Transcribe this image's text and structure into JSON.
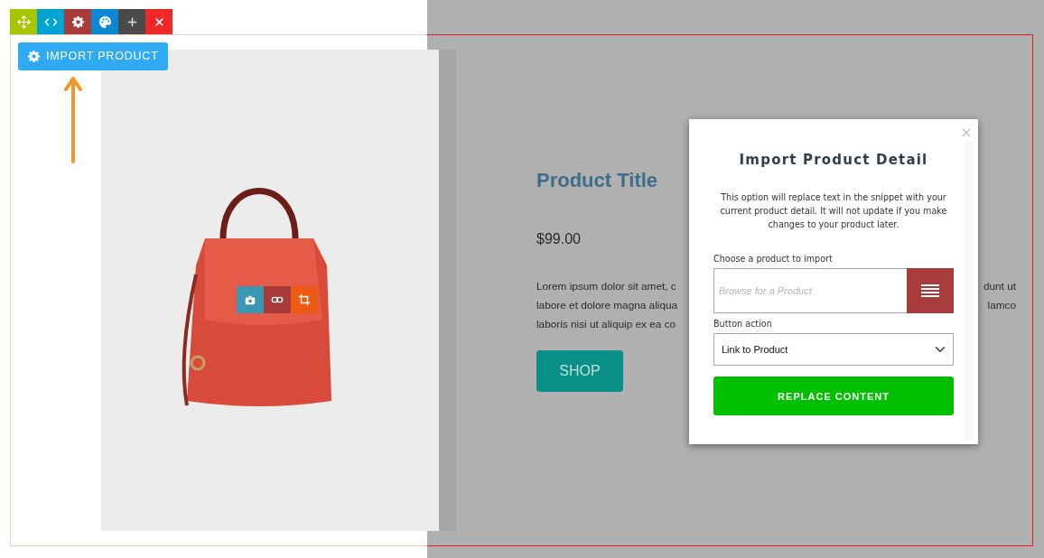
{
  "import_button": {
    "label": "IMPORT PRODUCT"
  },
  "product": {
    "title": "Product Title",
    "price": "$99.00",
    "description_lines": [
      {
        "left": "Lorem ipsum dolor sit amet, c",
        "right": "dunt ut"
      },
      {
        "left": "labore et dolore magna aliqua",
        "right": "lamco"
      },
      {
        "left": "laboris nisi ut aliquip ex ea co"
      }
    ],
    "button": "SHOP"
  },
  "dialog": {
    "title": "Import Product Detail",
    "description": "This option will replace text in the snippet with your current product detail. It will not update if you make changes to your product later.",
    "product_label": "Choose a product to import",
    "product_placeholder": "Browse for a Product",
    "action_label": "Button action",
    "action_value": "Link to Product",
    "submit": "REPLACE CONTENT"
  }
}
